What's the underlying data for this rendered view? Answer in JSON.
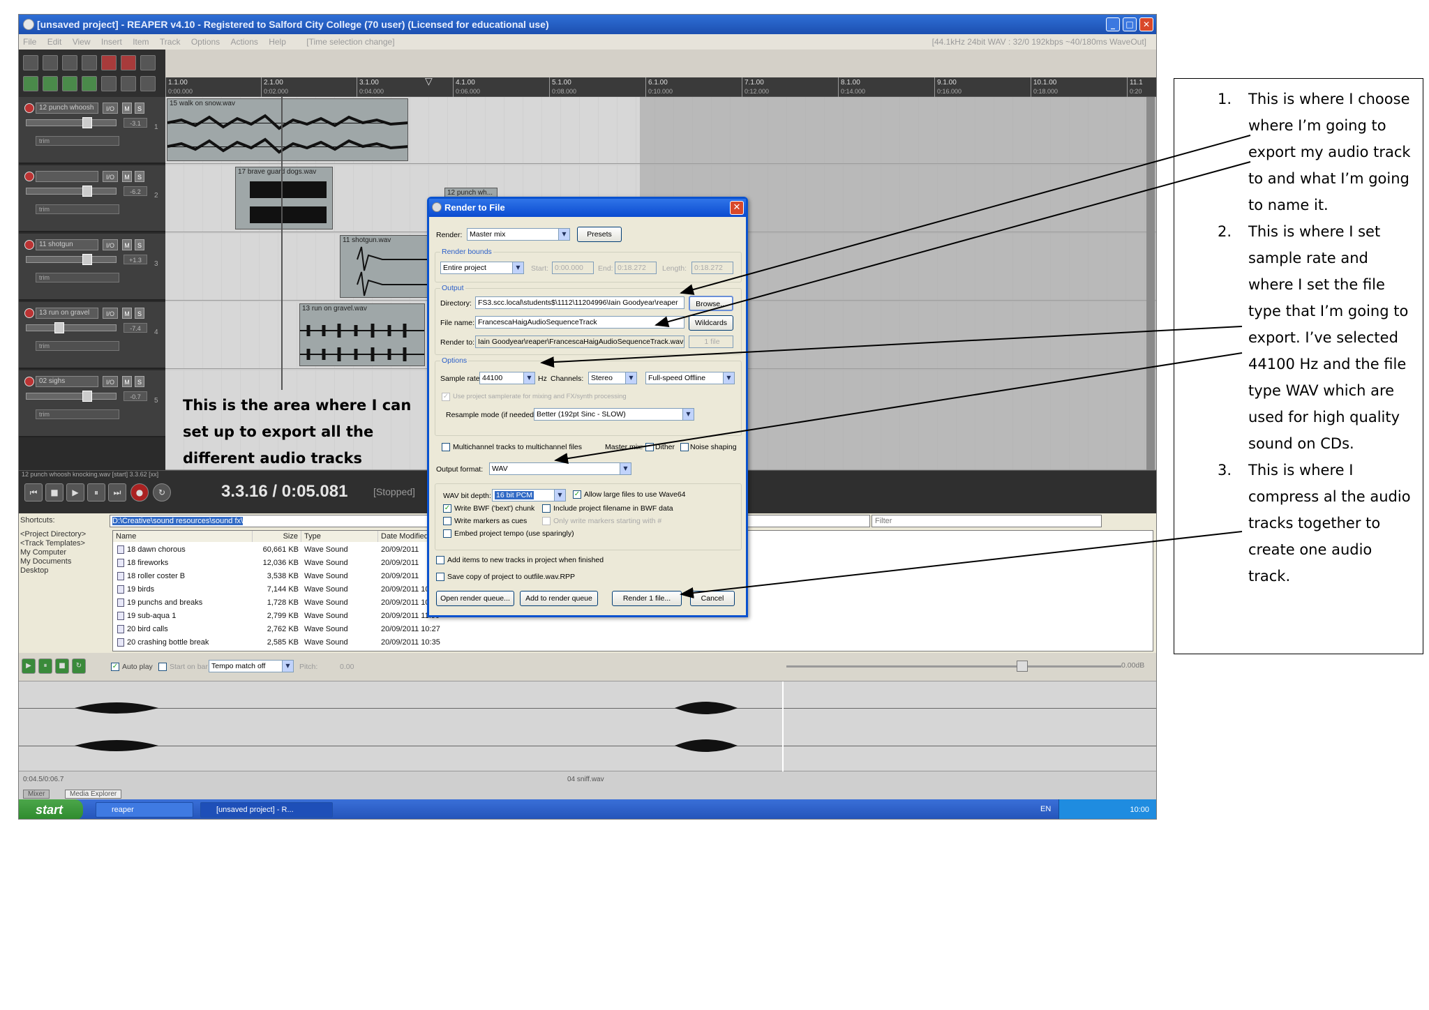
{
  "window": {
    "title": "[unsaved project] - REAPER v4.10 - Registered to Salford City College (70 user) (Licensed for educational use)",
    "menu": [
      "File",
      "Edit",
      "View",
      "Insert",
      "Item",
      "Track",
      "Options",
      "Actions",
      "Help"
    ],
    "menu_hint": "[Time selection change]",
    "format_info": "[44.1kHz 24bit WAV : 32/0 192kbps ~40/180ms WaveOut]"
  },
  "ruler": [
    {
      "bar": "1.1.00",
      "time": "0:00.000"
    },
    {
      "bar": "2.1.00",
      "time": "0:02.000"
    },
    {
      "bar": "3.1.00",
      "time": "0:04.000"
    },
    {
      "bar": "4.1.00",
      "time": "0:06.000"
    },
    {
      "bar": "5.1.00",
      "time": "0:08.000"
    },
    {
      "bar": "6.1.00",
      "time": "0:10.000"
    },
    {
      "bar": "7.1.00",
      "time": "0:12.000"
    },
    {
      "bar": "8.1.00",
      "time": "0:14.000"
    },
    {
      "bar": "9.1.00",
      "time": "0:16.000"
    },
    {
      "bar": "10.1.00",
      "time": "0:18.000"
    },
    {
      "bar": "11.1",
      "time": "0:20"
    }
  ],
  "tracks": [
    {
      "name": "12 punch whoosh",
      "io": "I/O",
      "m": "M",
      "s": "S",
      "vol": "-3.1",
      "sub": "trim",
      "num": "1"
    },
    {
      "name": "",
      "io": "I/O",
      "m": "M",
      "s": "S",
      "vol": "-6.2",
      "sub": "trim",
      "num": "2"
    },
    {
      "name": "11 shotgun",
      "io": "I/O",
      "m": "M",
      "s": "S",
      "vol": "+1.3",
      "sub": "trim",
      "num": "3"
    },
    {
      "name": "13 run on gravel",
      "io": "I/O",
      "m": "M",
      "s": "S",
      "vol": "-7.4",
      "sub": "trim",
      "num": "4"
    },
    {
      "name": "02 sighs",
      "io": "I/O",
      "m": "M",
      "s": "S",
      "vol": "-0.7",
      "sub": "trim",
      "num": "5"
    }
  ],
  "items": [
    {
      "label": "15 walk on snow.wav"
    },
    {
      "label": "17 brave guard dogs.wav"
    },
    {
      "label": "12 punch wh..."
    },
    {
      "label": "11 shotgun.wav"
    },
    {
      "label": "13 run on gravel.wav"
    }
  ],
  "transport": {
    "timecode": "3.3.16 / 0:05.081",
    "state": "[Stopped]",
    "status_line": "12 punch whoosh knocking.wav [start] 3.3.62 [xx]"
  },
  "explorer": {
    "shortcuts_label": "Shortcuts:",
    "path": "D:\\Creative\\sound resources\\sound fx\\",
    "filter": "Filter",
    "places": [
      "<Project Directory>",
      "<Track Templates>",
      "My Computer",
      "My Documents",
      "Desktop"
    ],
    "columns": [
      "Name",
      "Size",
      "Type",
      "Date Modified"
    ],
    "files": [
      {
        "name": "18 dawn chorous",
        "size": "60,661 KB",
        "type": "Wave Sound",
        "date": "20/09/2011"
      },
      {
        "name": "18 fireworks",
        "size": "12,036 KB",
        "type": "Wave Sound",
        "date": "20/09/2011"
      },
      {
        "name": "18 roller coster B",
        "size": "3,538 KB",
        "type": "Wave Sound",
        "date": "20/09/2011"
      },
      {
        "name": "19 birds",
        "size": "7,144 KB",
        "type": "Wave Sound",
        "date": "20/09/2011 10:27"
      },
      {
        "name": "19 punchs and breaks",
        "size": "1,728 KB",
        "type": "Wave Sound",
        "date": "20/09/2011 10:35"
      },
      {
        "name": "19 sub-aqua 1",
        "size": "2,799 KB",
        "type": "Wave Sound",
        "date": "20/09/2011 11:50"
      },
      {
        "name": "20 bird calls",
        "size": "2,762 KB",
        "type": "Wave Sound",
        "date": "20/09/2011 10:27"
      },
      {
        "name": "20 crashing bottle break",
        "size": "2,585 KB",
        "type": "Wave Sound",
        "date": "20/09/2011 10:35"
      }
    ],
    "autoplay": "Auto play",
    "start_on_bar": "Start on bar",
    "tempo_match": "Tempo match off",
    "pitch_label": "Pitch:",
    "pitch_value": "0.00",
    "volume_db": "0.00dB",
    "preview_time": "0:04.5/0:06.7",
    "preview_file": "04 sniff.wav",
    "tabs": [
      "Mixer",
      "Media Explorer"
    ]
  },
  "taskbar": {
    "start": "start",
    "items": [
      "reaper",
      "[unsaved project] - R..."
    ],
    "lang": "EN",
    "clock": "10:00"
  },
  "dialog": {
    "title": "Render to File",
    "render_label": "Render:",
    "render_value": "Master mix",
    "presets": "Presets",
    "render_bounds": "Render bounds",
    "bounds_value": "Entire project",
    "start_label": "Start:",
    "start_value": "0:00.000",
    "end_label": "End:",
    "end_value": "0:18.272",
    "length_label": "Length:",
    "length_value": "0:18.272",
    "output_group": "Output",
    "directory_label": "Directory:",
    "directory_value": "FS3.scc.local\\students$\\1112\\11204996\\Iain Goodyear\\reaper",
    "browse": "Browse...",
    "filename_label": "File name:",
    "filename_value": "FrancescaHaigAudioSequenceTrack",
    "wildcards": "Wildcards",
    "renderto_label": "Render to:",
    "renderto_value": "Iain Goodyear\\reaper\\FrancescaHaigAudioSequenceTrack.wav",
    "one_file": "1 file",
    "options_group": "Options",
    "samplerate_label": "Sample rate:",
    "samplerate_value": "44100",
    "hz": "Hz",
    "channels_label": "Channels:",
    "channels_value": "Stereo",
    "speed_value": "Full-speed Offline",
    "use_project": "Use project samplerate for mixing and FX/synth processing",
    "resample_label": "Resample mode (if needed):",
    "resample_value": "Better (192pt Sinc - SLOW)",
    "multichannel": "Multichannel tracks to multichannel files",
    "mastermix_label": "Master mix:",
    "dither": "Dither",
    "noise_shaping": "Noise shaping",
    "output_format_label": "Output format:",
    "output_format_value": "WAV",
    "wav_bitdepth_label": "WAV bit depth:",
    "wav_bitdepth_value": "16 bit PCM",
    "allow_large": "Allow large files to use Wave64",
    "write_bwf": "Write BWF ('bext') chunk",
    "include_filename": "Include project filename in BWF data",
    "write_markers": "Write markers as cues",
    "only_markers": "Only write markers starting with #",
    "embed_tempo": "Embed project tempo (use sparingly)",
    "add_items": "Add items to new tracks in project when finished",
    "save_copy": "Save copy of project to outfile.wav.RPP",
    "open_queue": "Open render queue...",
    "add_queue": "Add to render queue",
    "render_btn": "Render 1 file...",
    "cancel": "Cancel"
  },
  "annotations": {
    "area_note": "This is the area where I can set up to export all the different audio tracks",
    "notes": [
      {
        "n": "1.",
        "text": "This is where I choose where I’m going to export my audio track to and what I’m going to name it."
      },
      {
        "n": "2.",
        "text": "This is where I set sample rate and where I set the file type that I’m going to export. I’ve selected 44100 Hz and the file type WAV which are used for high quality sound on CDs."
      },
      {
        "n": "3.",
        "text": "This is where I compress al the audio tracks together to create one audio track."
      }
    ]
  }
}
